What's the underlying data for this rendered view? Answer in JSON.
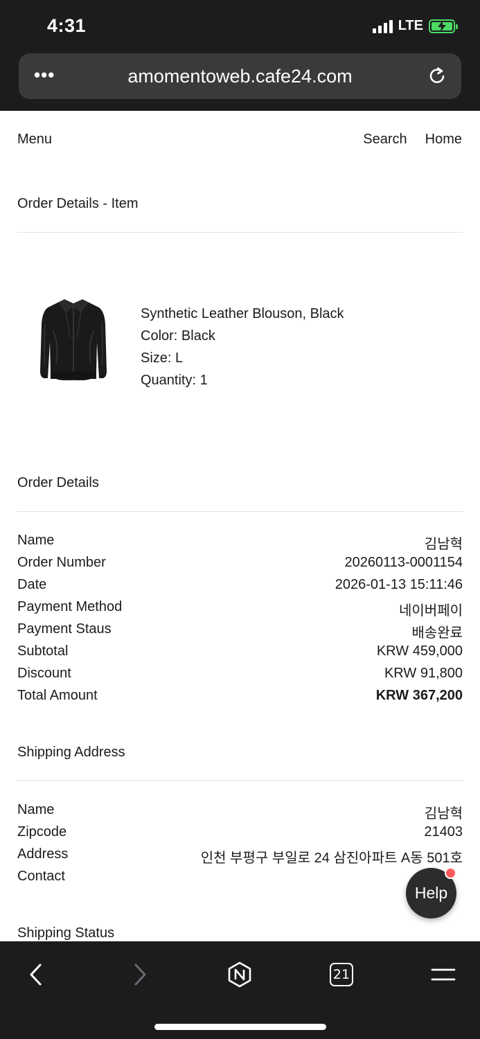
{
  "status_bar": {
    "time": "4:31",
    "network": "LTE",
    "battery_icon": "battery-charging-icon",
    "battery_color": "#4cd964"
  },
  "browser": {
    "url": "amomentoweb.cafe24.com",
    "more_icon": "more-dots-icon",
    "reload_icon": "reload-icon",
    "tab_count": "21"
  },
  "nav": {
    "menu": "Menu",
    "search": "Search",
    "home": "Home"
  },
  "order_item": {
    "section_title": "Order Details - Item",
    "product_name": "Synthetic Leather Blouson, Black",
    "color": "Color: Black",
    "size": "Size: L",
    "quantity": "Quantity: 1"
  },
  "order_details": {
    "section_title": "Order Details",
    "rows": [
      {
        "label": "Name",
        "value": "김남혁"
      },
      {
        "label": "Order Number",
        "value": "20260113-0001154"
      },
      {
        "label": "Date",
        "value": "2026-01-13 15:11:46"
      },
      {
        "label": "Payment Method",
        "value": "네이버페이"
      },
      {
        "label": "Payment Staus",
        "value": "배송완료"
      },
      {
        "label": "Subtotal",
        "value": "KRW 459,000"
      },
      {
        "label": "Discount",
        "value": "KRW 91,800"
      },
      {
        "label": "Total Amount",
        "value": "KRW 367,200"
      }
    ]
  },
  "shipping_address": {
    "section_title": "Shipping Address",
    "rows": [
      {
        "label": "Name",
        "value": "김남혁"
      },
      {
        "label": "Zipcode",
        "value": "21403"
      },
      {
        "label": "Address",
        "value": "인천 부평구 부일로 24 삼진아파트 A동 501호"
      },
      {
        "label": "Contact",
        "value": ""
      }
    ]
  },
  "shipping_status": {
    "section_title": "Shipping Status"
  },
  "help": {
    "label": "Help",
    "badge_color": "#ff5a5a"
  }
}
